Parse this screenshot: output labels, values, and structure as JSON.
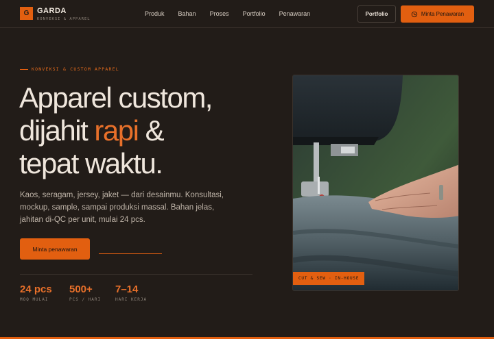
{
  "brand": {
    "logo_letter": "G",
    "name": "GARDA",
    "tagline": "KONVEKSI & APPAREL"
  },
  "nav": [
    "Produk",
    "Bahan",
    "Proses",
    "Portfolio",
    "Penawaran"
  ],
  "header_actions": {
    "portfolio": "Portfolio",
    "quote": "Minta Penawaran",
    "quote_icon": "whatsapp-icon"
  },
  "hero": {
    "eyebrow": "KONVEKSI & CUSTOM APPAREL",
    "headline_line1": "Apparel custom,",
    "headline_line2_pre": "dijahit ",
    "headline_accent": "rapi",
    "headline_line2_post": " &",
    "headline_line3": "tepat waktu.",
    "lead": "Kaos, seragam, jersey, jaket — dari desainmu. Konsultasi, mockup, sample, sampai produksi massal. Bahan jelas, jahitan di-QC per unit, mulai 24 pcs.",
    "primary_cta": "Minta penawaran",
    "secondary_cta": ""
  },
  "stats": [
    {
      "value": "24 pcs",
      "label": "MOQ MULAI"
    },
    {
      "value": "500+",
      "label": "PCS / HARI"
    },
    {
      "value": "7–14",
      "label": "HARI KERJA"
    }
  ],
  "photo": {
    "badge": "CUT & SEW · IN-HOUSE",
    "subject": "sewing-machine-photo"
  },
  "colors": {
    "accent": "#e25f10",
    "background": "#221c18",
    "text": "#efe6dc"
  }
}
